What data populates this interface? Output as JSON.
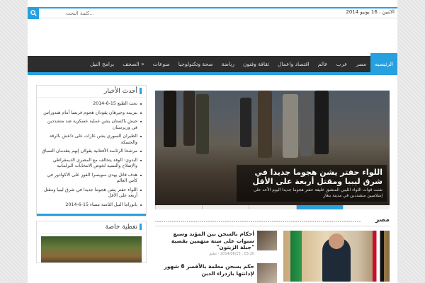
{
  "topbar": {
    "date": "الاثنين ، 16 يونيو 2014",
    "search_placeholder": "كلمة البحث..."
  },
  "nav": {
    "items": [
      "الرئيسيه",
      "مصر",
      "عرب",
      "عالم",
      "اقتصاد واعمال",
      "ثقافة وفنون",
      "رياضة",
      "صحة وتكنولوجيا",
      "منوعات",
      "الصحف »",
      "برامج النيل"
    ],
    "active_index": 0
  },
  "sidebar": {
    "latest_title": "أحدث الأخبار",
    "latest_items": [
      "نحت الطبع 15-6-2014",
      "بنزيمة وجيرهان يقودان هجوم فرنسا أمام هندوراس",
      "جيش باكستان يشن عملية عسكرية ضد متشددين في وزيرستان",
      "الطيران السوري يشن غارات على داعش بالرقة والحسكة",
      "مرشحا الرئاسة الأفغانية يقولان إنهم يتقدمان السباق",
      "البدوي: الوفد يتحالف مع المصري الديمقراطي والإصلاح والتنمية لخوض الانتخابات البرلمانية",
      "هدف قاتل يهدي سويسرا الفوز على الاكوادور في كأس العالم",
      "اللواء حفتر يشن هجوما جديدا في شرق ليبيا ومقتل أربعة على الأقل",
      "بانوراما النيل الثامنة مساء 15-6-2014"
    ],
    "special_title": "تغطية خاصة"
  },
  "slider": {
    "title": "اللواء حفتر يشن هجوما جديدا في شرق ليبيا ومقتل أربعة على الأقل",
    "excerpt": "شنت قوات اللواء الليبي المنشق خليفة حفتر هجوما جديدا اليوم الأحد على إسلاميين متشددين في مدينة بنغاز"
  },
  "egypt_section": {
    "label": "مصر",
    "articles": [
      {
        "title": "أحكام بالسجن بين المؤبد وسبع سنوات على ستة متهمين بقضية \"جبلة الزيتون\"",
        "meta": "03:20 , 2014/06/15 - تعليق"
      },
      {
        "title": "حكم بسجن معلمة بالأقصر 6 شهور لإدانتها بازدراء الدين",
        "meta": ""
      }
    ]
  },
  "colors": {
    "accent": "#27a0e0",
    "nav_bg": "#2d2d2d"
  },
  "icons": {
    "search": "search-icon"
  }
}
